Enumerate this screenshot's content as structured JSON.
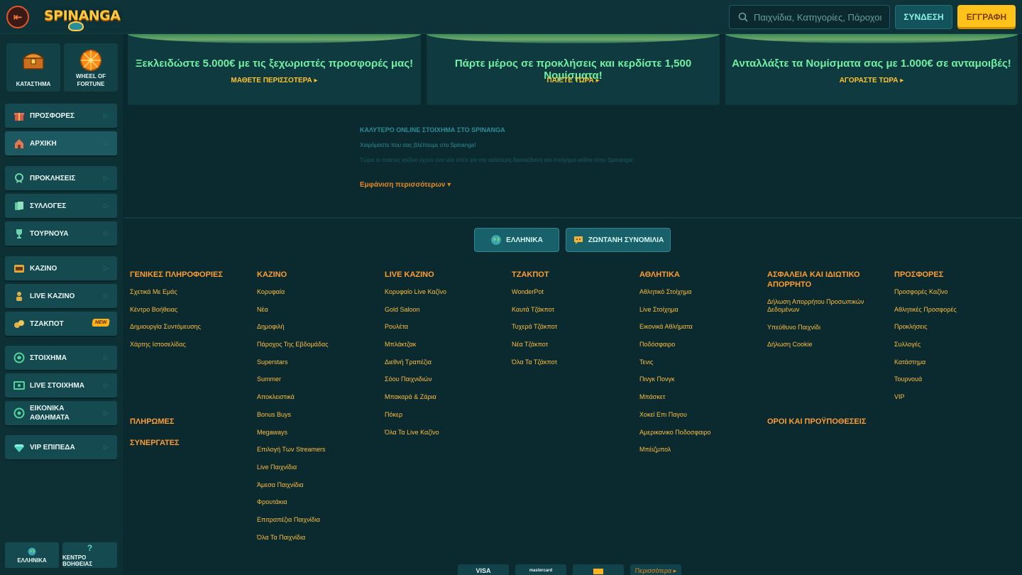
{
  "header": {
    "logo_text": "SPINANGA",
    "search_placeholder": "Παιχνίδια, Κατηγορίες, Πάροχοι",
    "login_label": "ΣΥΝΔΕΣΗ",
    "register_label": "ΕΓΓΡΑΦΗ"
  },
  "sidebar": {
    "tiles": [
      {
        "label": "ΚΑΤΑΣΤΗΜΑ",
        "icon": "chest-icon"
      },
      {
        "label": "WHEEL OF FORTUNE",
        "icon": "wheel-icon"
      }
    ],
    "group1": [
      {
        "label": "ΠΡΟΣΦΟΡΕΣ",
        "icon": "gift-icon"
      },
      {
        "label": "ΑΡΧΙΚΗ",
        "icon": "home-icon"
      }
    ],
    "group2": [
      {
        "label": "ΠΡΟΚΛΗΣΕΙΣ",
        "icon": "medal-icon"
      },
      {
        "label": "ΣΥΛΛΟΓΕΣ",
        "icon": "cards-icon"
      },
      {
        "label": "ΤΟΥΡΝΟΥΑ",
        "icon": "trophy-icon"
      }
    ],
    "group3": [
      {
        "label": "ΚΑΖΙΝΟ",
        "icon": "slot-icon"
      },
      {
        "label": "LIVE ΚΑΖΙΝΟ",
        "icon": "dealer-icon"
      },
      {
        "label": "ΤΖΑΚΠΟΤ",
        "icon": "jackpot-icon",
        "badge": "NEW"
      }
    ],
    "group4": [
      {
        "label": "ΣΤΟΙΧΗΜΑ",
        "icon": "ball-icon"
      },
      {
        "label": "LIVE ΣΤΟΙΧΗΜΑ",
        "icon": "live-screen-icon"
      },
      {
        "label": "ΕΙΚΟΝΙΚΑ ΑΘΛΗΜΑΤΑ",
        "icon": "virtual-icon"
      }
    ],
    "group5": [
      {
        "label": "VIP ΕΠΙΠΕΔΑ",
        "icon": "diamond-icon"
      }
    ],
    "bottom": {
      "language": "ΕΛΛΗΝΙΚΑ",
      "help": "ΚΕΝΤΡΟ ΒΟΗΘΕΙΑΣ"
    }
  },
  "promos": [
    {
      "title": "Ξεκλειδώστε 5.000€ με τις ξεχωριστές προσφορές μας!",
      "link": "ΜΑΘΕΤΕ ΠΕΡΙΣΣΟΤΕΡΑ"
    },
    {
      "title": "Πάρτε μέρος σε προκλήσεις και κερδίστε 1,500 Νομίσματα!",
      "link": "ΠΑΙΞΤΕ ΤΩΡΑ"
    },
    {
      "title": "Ανταλλάξτε τα Νομίσματα σας με 1.000€ σε ανταμοιβές!",
      "link": "ΑΓΟΡΑΣΤΕ ΤΩΡΑ"
    }
  ],
  "seo": {
    "heading": "ΚΑΛΥΤΕΡΟ ONLINE ΣΤΟΙΧΗΜΑ ΣΤΟ SPINANGA",
    "greeting": "Χαιρόμαστε που σας βλέπουμε στο Spinanga!",
    "faded": "Τώρα οι παίκτες καζίνο έχουν ένα νέο σπίτι για την καλύτερη διασκέδαση και στοίχημα online στην Spinanga!",
    "show_more": "Εμφάνιση περισσότερων"
  },
  "footer": {
    "language_button": "ΕΛΛΗΝΙΚΑ",
    "chat_button": "ΖΩΝΤΑΝΗ ΣΥΝΟΜΙΛΙΑ",
    "columns": [
      {
        "heading": "ΓΕΝΙΚΕΣ ΠΛΗΡΟΦΟΡΙΕΣ",
        "links": [
          "Σχετικά Με Εμάς",
          "Κέντρο Βοήθειας",
          "Δημιουργία Συντόμευσης",
          "Χάρτης Ιστοσελίδας"
        ]
      },
      {
        "heading": "ΚΑΖΙΝΟ",
        "links": [
          "Κορυφαία",
          "Νέα",
          "Δημοφιλή",
          "Πάροχος Της Εβδομάδας",
          "Superstars",
          "Summer",
          "Αποκλειστικά",
          "Bonus Buys",
          "Megaways",
          "Επιλογή Των Streamers",
          "Live Παιχνίδια",
          "Άμεσα Παιχνίδια",
          "Φρουτάκια",
          "Επιτραπέζια Παιχνίδια",
          "Όλα Τα Παιχνίδια"
        ]
      },
      {
        "heading": "LIVE ΚΑΖΙΝΟ",
        "links": [
          "Κορυφαίο Live Καζίνο",
          "Gold Saloon",
          "Ρουλέτα",
          "Μπλάκτζακ",
          "Διεθνή Τραπέζια",
          "Σόου Παιχνιδιών",
          "Μπακαρά & Ζάρια",
          "Πόκερ",
          "Όλα Τα Live Καζίνο"
        ]
      },
      {
        "heading": "ΤΖΑΚΠΟΤ",
        "links": [
          "WonderPot",
          "Καυτά Τζάκποτ",
          "Τυχερά Τζάκποτ",
          "Νέα Τζάκποτ",
          "Όλα Τα Τζάκποτ"
        ]
      },
      {
        "heading": "ΑΘΛΗΤΙΚΑ",
        "links": [
          "Αθλητικό Στοίχημα",
          "Live Στοίχημα",
          "Εικονικά Αθλήματα",
          "Ποδόσφαιρο",
          "Τενις",
          "Πινγκ Πονγκ",
          "Μπάσκετ",
          "Χοκεϊ Επι Παγου",
          "Αμερικανικο Ποδοσφαιρο",
          "Μπέιζμπολ"
        ]
      },
      {
        "heading": "ΑΣΦΑΛΕΙΑ ΚΑΙ ΙΔΙΩΤΙΚΟ ΑΠΟΡΡΗΤΟ",
        "links": [
          "Δήλωση Απορρήτου Προσωπικών Δεδομένων",
          "Υπεύθυνο Παιχνίδι",
          "Δήλωση Cookie"
        ]
      },
      {
        "heading": "ΠΡΟΣΦΟΡΕΣ",
        "links": [
          "Προσφορές Καζίνο",
          "Αθλητικές Προσφορές",
          "Προκλήσεις",
          "Συλλογές",
          "Κατάστημα",
          "Τουρνουά",
          "VIP"
        ]
      }
    ],
    "payments_heading": "ΠΛΗΡΩΜΕΣ",
    "partners_heading": "ΣΥΝΕΡΓΑΤΕΣ",
    "terms_heading": "ΟΡΟΙ ΚΑΙ ΠΡΟΫΠΟΘΕΣΕΙΣ",
    "payment_chips": [
      "VISA",
      "mastercard",
      "",
      "Περισσότερα"
    ]
  }
}
